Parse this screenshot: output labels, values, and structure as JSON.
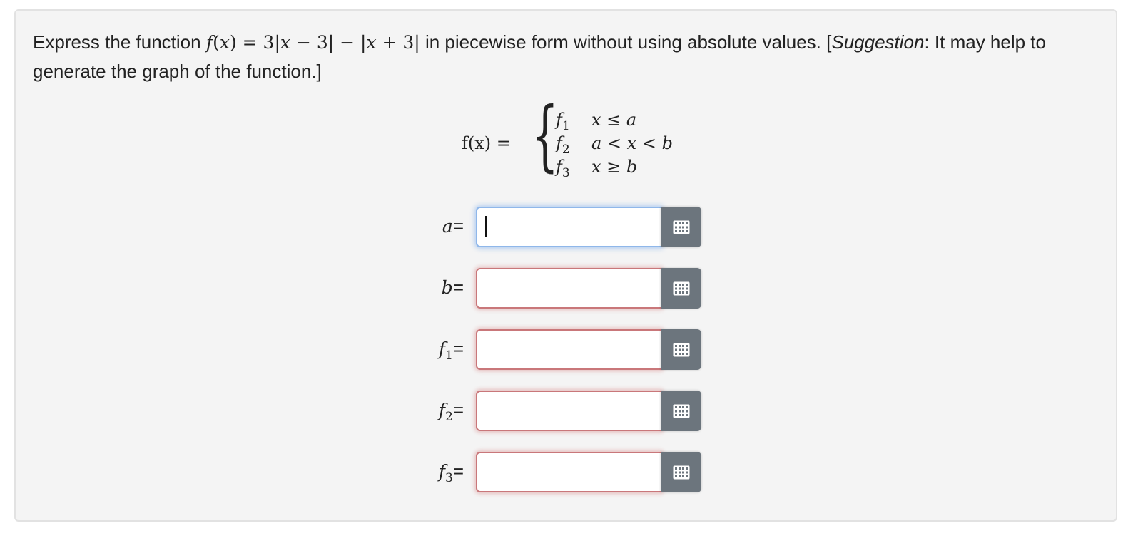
{
  "question": {
    "intro": "Express the function",
    "formula": {
      "f": "f",
      "x": "x",
      "eq": " = 3|",
      "mid1": " − 3| − |",
      "mid2": " + 3|"
    },
    "after": " in piecewise form without using absolute values. [",
    "suggestion_word": "Suggestion",
    "suggestion_rest": ": It may help to generate the graph of the function.]"
  },
  "piecewise": {
    "lhs": "f(x) =",
    "rows": [
      {
        "f": "f",
        "sub": "1",
        "cond": "x ≤ a"
      },
      {
        "f": "f",
        "sub": "2",
        "cond": "a < x < b"
      },
      {
        "f": "f",
        "sub": "3",
        "cond": "x ≥ b"
      }
    ]
  },
  "fields": [
    {
      "var": "a",
      "sub": "",
      "eq": "=",
      "value": "",
      "state": "focused"
    },
    {
      "var": "b",
      "sub": "",
      "eq": "=",
      "value": "",
      "state": "invalid"
    },
    {
      "var": "f",
      "sub": "1",
      "eq": "=",
      "value": "",
      "state": "invalid"
    },
    {
      "var": "f",
      "sub": "2",
      "eq": "=",
      "value": "",
      "state": "invalid"
    },
    {
      "var": "f",
      "sub": "3",
      "eq": "=",
      "value": "",
      "state": "invalid"
    }
  ],
  "icons": {
    "keyboard": "grid-keyboard-icon"
  },
  "colors": {
    "card_bg": "#f4f4f4",
    "button_bg": "#6c757d",
    "invalid_border": "#c9777a",
    "focus_border": "#8fb7ea"
  }
}
